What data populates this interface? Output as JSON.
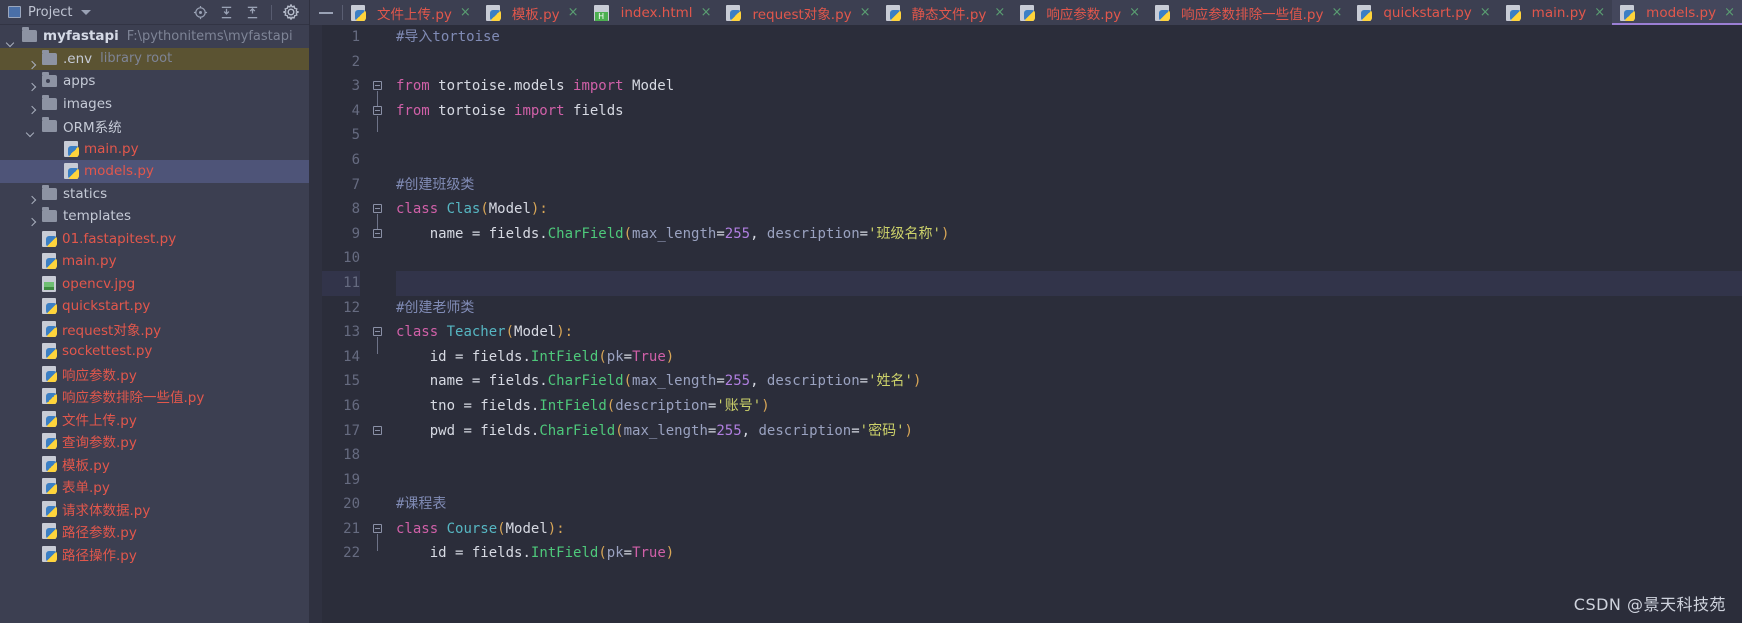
{
  "sidebar": {
    "header": {
      "title": "Project",
      "icons": [
        "project-view-icon",
        "caret-down-icon",
        "locate-icon",
        "expand-all-icon",
        "collapse-all-icon",
        "gear-icon"
      ]
    },
    "tree": [
      {
        "level": 0,
        "arrow": "down",
        "icon": "folder",
        "name": "myfastapi",
        "bold": true,
        "path": "F:\\pythonitems\\myfastapi",
        "state": "normal"
      },
      {
        "level": 1,
        "arrow": "right",
        "icon": "folder",
        "name": ".env",
        "badge": "library root",
        "state": "env"
      },
      {
        "level": 1,
        "arrow": "right",
        "icon": "folder-src",
        "name": "apps",
        "state": "normal"
      },
      {
        "level": 1,
        "arrow": "right",
        "icon": "folder",
        "name": "images",
        "state": "normal"
      },
      {
        "level": 1,
        "arrow": "down",
        "icon": "folder",
        "name": "ORM系统",
        "state": "normal"
      },
      {
        "level": 2,
        "arrow": "none",
        "icon": "python",
        "name": "main.py",
        "state": "normal"
      },
      {
        "level": 2,
        "arrow": "none",
        "icon": "python",
        "name": "models.py",
        "state": "selected"
      },
      {
        "level": 1,
        "arrow": "right",
        "icon": "folder",
        "name": "statics",
        "state": "normal"
      },
      {
        "level": 1,
        "arrow": "right",
        "icon": "folder",
        "name": "templates",
        "state": "normal"
      },
      {
        "level": 1,
        "arrow": "none",
        "icon": "python",
        "name": "01.fastapitest.py",
        "state": "normal"
      },
      {
        "level": 1,
        "arrow": "none",
        "icon": "python",
        "name": "main.py",
        "state": "normal"
      },
      {
        "level": 1,
        "arrow": "none",
        "icon": "image",
        "name": "opencv.jpg",
        "state": "normal"
      },
      {
        "level": 1,
        "arrow": "none",
        "icon": "python",
        "name": "quickstart.py",
        "state": "normal"
      },
      {
        "level": 1,
        "arrow": "none",
        "icon": "python",
        "name": "request对象.py",
        "state": "normal"
      },
      {
        "level": 1,
        "arrow": "none",
        "icon": "python",
        "name": "sockettest.py",
        "state": "normal"
      },
      {
        "level": 1,
        "arrow": "none",
        "icon": "python",
        "name": "响应参数.py",
        "state": "normal"
      },
      {
        "level": 1,
        "arrow": "none",
        "icon": "python",
        "name": "响应参数排除一些值.py",
        "state": "normal"
      },
      {
        "level": 1,
        "arrow": "none",
        "icon": "python",
        "name": "文件上传.py",
        "state": "normal"
      },
      {
        "level": 1,
        "arrow": "none",
        "icon": "python",
        "name": "查询参数.py",
        "state": "normal"
      },
      {
        "level": 1,
        "arrow": "none",
        "icon": "python",
        "name": "模板.py",
        "state": "normal"
      },
      {
        "level": 1,
        "arrow": "none",
        "icon": "python",
        "name": "表单.py",
        "state": "normal"
      },
      {
        "level": 1,
        "arrow": "none",
        "icon": "python",
        "name": "请求体数据.py",
        "state": "normal"
      },
      {
        "level": 1,
        "arrow": "none",
        "icon": "python",
        "name": "路径参数.py",
        "state": "normal"
      },
      {
        "level": 1,
        "arrow": "none",
        "icon": "python",
        "name": "路径操作.py",
        "state": "normal"
      }
    ]
  },
  "tabs": [
    {
      "label": "文件上传.py",
      "icon": "python",
      "active": false,
      "close": "×"
    },
    {
      "label": "模板.py",
      "icon": "python",
      "active": false,
      "close": "×"
    },
    {
      "label": "index.html",
      "icon": "html",
      "active": false,
      "close": "×"
    },
    {
      "label": "request对象.py",
      "icon": "python",
      "active": false,
      "close": "×"
    },
    {
      "label": "静态文件.py",
      "icon": "python",
      "active": false,
      "close": "×"
    },
    {
      "label": "响应参数.py",
      "icon": "python",
      "active": false,
      "close": "×"
    },
    {
      "label": "响应参数排除一些值.py",
      "icon": "python",
      "active": false,
      "close": "×"
    },
    {
      "label": "quickstart.py",
      "icon": "python",
      "active": false,
      "close": "×"
    },
    {
      "label": "main.py",
      "icon": "python",
      "active": false,
      "close": "×"
    },
    {
      "label": "models.py",
      "icon": "python",
      "active": true,
      "close": "×"
    }
  ],
  "editor": {
    "current_line": 11,
    "line_numbers": [
      1,
      2,
      3,
      4,
      5,
      6,
      7,
      8,
      9,
      10,
      11,
      12,
      13,
      14,
      15,
      16,
      17,
      18,
      19,
      20,
      21,
      22
    ],
    "lines": [
      {
        "n": 1,
        "tokens": [
          {
            "t": "#导入tortoise",
            "c": "com"
          }
        ]
      },
      {
        "n": 2,
        "tokens": []
      },
      {
        "n": 3,
        "tokens": [
          {
            "t": "from",
            "c": "kw"
          },
          {
            "t": " tortoise.models ",
            "c": "txt"
          },
          {
            "t": "import",
            "c": "kw"
          },
          {
            "t": " Model",
            "c": "txt"
          }
        ]
      },
      {
        "n": 4,
        "tokens": [
          {
            "t": "from",
            "c": "kw"
          },
          {
            "t": " tortoise ",
            "c": "txt"
          },
          {
            "t": "import",
            "c": "kw"
          },
          {
            "t": " fields",
            "c": "txt"
          }
        ]
      },
      {
        "n": 5,
        "tokens": []
      },
      {
        "n": 6,
        "tokens": []
      },
      {
        "n": 7,
        "tokens": [
          {
            "t": "#创建班级类",
            "c": "com"
          }
        ]
      },
      {
        "n": 8,
        "tokens": [
          {
            "t": "class",
            "c": "kw"
          },
          {
            "t": " ",
            "c": "txt"
          },
          {
            "t": "Clas",
            "c": "cls"
          },
          {
            "t": "(",
            "c": "brk"
          },
          {
            "t": "Model",
            "c": "txt"
          },
          {
            "t": ")",
            "c": "brk"
          },
          {
            "t": ":",
            "c": "brk"
          }
        ]
      },
      {
        "n": 9,
        "tokens": [
          {
            "t": "    name ",
            "c": "txt"
          },
          {
            "t": "=",
            "c": "op"
          },
          {
            "t": " fields.",
            "c": "txt"
          },
          {
            "t": "CharField",
            "c": "fn"
          },
          {
            "t": "(",
            "c": "brk"
          },
          {
            "t": "max_length",
            "c": "par"
          },
          {
            "t": "=",
            "c": "op"
          },
          {
            "t": "255",
            "c": "num"
          },
          {
            "t": ", ",
            "c": "txt"
          },
          {
            "t": "description",
            "c": "par"
          },
          {
            "t": "=",
            "c": "op"
          },
          {
            "t": "'班级名称'",
            "c": "str"
          },
          {
            "t": ")",
            "c": "brk"
          }
        ]
      },
      {
        "n": 10,
        "tokens": []
      },
      {
        "n": 11,
        "tokens": []
      },
      {
        "n": 12,
        "tokens": [
          {
            "t": "#创建老师类",
            "c": "com"
          }
        ]
      },
      {
        "n": 13,
        "tokens": [
          {
            "t": "class",
            "c": "kw"
          },
          {
            "t": " ",
            "c": "txt"
          },
          {
            "t": "Teacher",
            "c": "cls"
          },
          {
            "t": "(",
            "c": "brk"
          },
          {
            "t": "Model",
            "c": "txt"
          },
          {
            "t": ")",
            "c": "brk"
          },
          {
            "t": ":",
            "c": "brk"
          }
        ]
      },
      {
        "n": 14,
        "tokens": [
          {
            "t": "    id ",
            "c": "txt"
          },
          {
            "t": "=",
            "c": "op"
          },
          {
            "t": " fields.",
            "c": "txt"
          },
          {
            "t": "IntField",
            "c": "fn"
          },
          {
            "t": "(",
            "c": "brk"
          },
          {
            "t": "pk",
            "c": "par"
          },
          {
            "t": "=",
            "c": "op"
          },
          {
            "t": "True",
            "c": "bool"
          },
          {
            "t": ")",
            "c": "brk"
          }
        ]
      },
      {
        "n": 15,
        "tokens": [
          {
            "t": "    name ",
            "c": "txt"
          },
          {
            "t": "=",
            "c": "op"
          },
          {
            "t": " fields.",
            "c": "txt"
          },
          {
            "t": "CharField",
            "c": "fn"
          },
          {
            "t": "(",
            "c": "brk"
          },
          {
            "t": "max_length",
            "c": "par"
          },
          {
            "t": "=",
            "c": "op"
          },
          {
            "t": "255",
            "c": "num"
          },
          {
            "t": ", ",
            "c": "txt"
          },
          {
            "t": "description",
            "c": "par"
          },
          {
            "t": "=",
            "c": "op"
          },
          {
            "t": "'姓名'",
            "c": "str"
          },
          {
            "t": ")",
            "c": "brk"
          }
        ]
      },
      {
        "n": 16,
        "tokens": [
          {
            "t": "    tno ",
            "c": "txt"
          },
          {
            "t": "=",
            "c": "op"
          },
          {
            "t": " fields.",
            "c": "txt"
          },
          {
            "t": "IntField",
            "c": "fn"
          },
          {
            "t": "(",
            "c": "brk"
          },
          {
            "t": "description",
            "c": "par"
          },
          {
            "t": "=",
            "c": "op"
          },
          {
            "t": "'账号'",
            "c": "str"
          },
          {
            "t": ")",
            "c": "brk"
          }
        ]
      },
      {
        "n": 17,
        "tokens": [
          {
            "t": "    pwd ",
            "c": "txt"
          },
          {
            "t": "=",
            "c": "op"
          },
          {
            "t": " fields.",
            "c": "txt"
          },
          {
            "t": "CharField",
            "c": "fn"
          },
          {
            "t": "(",
            "c": "brk"
          },
          {
            "t": "max_length",
            "c": "par"
          },
          {
            "t": "=",
            "c": "op"
          },
          {
            "t": "255",
            "c": "num"
          },
          {
            "t": ", ",
            "c": "txt"
          },
          {
            "t": "description",
            "c": "par"
          },
          {
            "t": "=",
            "c": "op"
          },
          {
            "t": "'密码'",
            "c": "str"
          },
          {
            "t": ")",
            "c": "brk"
          }
        ]
      },
      {
        "n": 18,
        "tokens": []
      },
      {
        "n": 19,
        "tokens": []
      },
      {
        "n": 20,
        "tokens": [
          {
            "t": "#课程表",
            "c": "com"
          }
        ]
      },
      {
        "n": 21,
        "tokens": [
          {
            "t": "class",
            "c": "kw"
          },
          {
            "t": " ",
            "c": "txt"
          },
          {
            "t": "Course",
            "c": "cls"
          },
          {
            "t": "(",
            "c": "brk"
          },
          {
            "t": "Model",
            "c": "txt"
          },
          {
            "t": ")",
            "c": "brk"
          },
          {
            "t": ":",
            "c": "brk"
          }
        ]
      },
      {
        "n": 22,
        "tokens": [
          {
            "t": "    id ",
            "c": "txt"
          },
          {
            "t": "=",
            "c": "op"
          },
          {
            "t": " fields.",
            "c": "txt"
          },
          {
            "t": "IntField",
            "c": "fn"
          },
          {
            "t": "(",
            "c": "brk"
          },
          {
            "t": "pk",
            "c": "par"
          },
          {
            "t": "=",
            "c": "op"
          },
          {
            "t": "True",
            "c": "bool"
          },
          {
            "t": ")",
            "c": "brk"
          }
        ]
      }
    ],
    "fold_markers": [
      {
        "line": 3,
        "type": "box"
      },
      {
        "line": 4,
        "type": "box"
      },
      {
        "line": 8,
        "type": "box"
      },
      {
        "line": 9,
        "type": "end"
      },
      {
        "line": 13,
        "type": "box"
      },
      {
        "line": 17,
        "type": "end"
      },
      {
        "line": 21,
        "type": "box"
      }
    ]
  },
  "watermark": "CSDN @景天科技苑",
  "colors": {
    "editor_bg": "#2b2d3a",
    "sidebar_bg": "#3c3f51",
    "tab_active_bg": "#44475c",
    "tab_active_underline": "#9b7fd4",
    "selection_bg": "#4e5478",
    "env_row_bg": "#5b5332",
    "current_line_bg": "#32344a",
    "py_file_text": "#e2574c",
    "keyword": "#d060a8",
    "class_name": "#56b6c2",
    "function": "#4ec97b",
    "string": "#cdd26a",
    "number": "#b07fe0",
    "comment": "#808bb5",
    "param": "#9aa2c0",
    "bracket": "#d8a657",
    "margin_guide": "#8e9ac8"
  }
}
